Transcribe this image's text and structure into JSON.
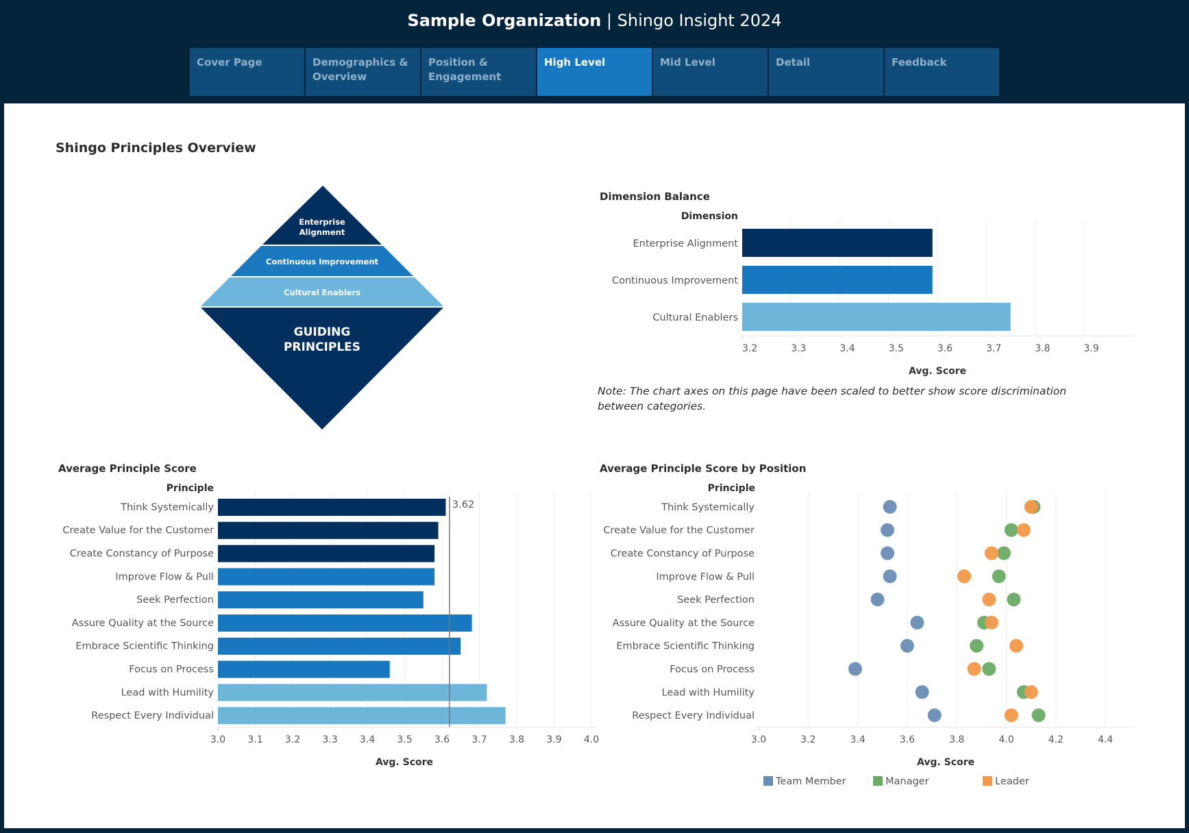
{
  "header": {
    "org_name": "Sample Organization",
    "separator": " | ",
    "report_name": "Shingo Insight 2024"
  },
  "tabs": [
    {
      "label": "Cover Page",
      "active": false
    },
    {
      "label": "Demographics & Overview",
      "active": false
    },
    {
      "label": "Position & Engagement",
      "active": false
    },
    {
      "label": "High Level",
      "active": true
    },
    {
      "label": "Mid Level",
      "active": false
    },
    {
      "label": "Detail",
      "active": false
    },
    {
      "label": "Feedback",
      "active": false
    }
  ],
  "page_title": "Shingo Principles Overview",
  "pyramid": {
    "top": [
      "Enterprise",
      "Alignment"
    ],
    "middle": "Continuous Improvement",
    "lower": "Cultural Enablers",
    "base": [
      "GUIDING",
      "PRINCIPLES"
    ]
  },
  "colors": {
    "enterprise_alignment": "#022f5e",
    "continuous_improvement": "#1777bf",
    "cultural_enablers": "#6eb5da",
    "team_member": "#6a8db5",
    "manager": "#6aaa64",
    "leader": "#f2984a",
    "reference_line": "#888888"
  },
  "note": "Note: The  chart axes on this page have been scaled to better show score discrimination between categories.",
  "chart_data": [
    {
      "id": "dimension_balance",
      "type": "bar",
      "orientation": "horizontal",
      "title": "Dimension Balance",
      "category_header": "Dimension",
      "categories": [
        "Enterprise Alignment",
        "Continuous Improvement",
        "Cultural Enablers"
      ],
      "values": [
        3.59,
        3.59,
        3.75
      ],
      "bar_colors": [
        "#022f5e",
        "#1777bf",
        "#6eb5da"
      ],
      "xlabel": "Avg. Score",
      "xlim": [
        3.2,
        4.0
      ],
      "xticks": [
        "3.2",
        "3.3",
        "3.4",
        "3.5",
        "3.6",
        "3.7",
        "3.8",
        "3.9"
      ],
      "grid": true
    },
    {
      "id": "average_principle_score",
      "type": "bar",
      "orientation": "horizontal",
      "title": "Average Principle Score",
      "category_header": "Principle",
      "categories": [
        "Think Systemically",
        "Create Value for the Customer",
        "Create Constancy of Purpose",
        "Improve Flow & Pull",
        "Seek Perfection",
        "Assure Quality at the Source",
        "Embrace Scientific Thinking",
        "Focus on Process",
        "Lead with Humility",
        "Respect Every Individual"
      ],
      "values": [
        3.61,
        3.59,
        3.58,
        3.58,
        3.55,
        3.68,
        3.65,
        3.46,
        3.72,
        3.77
      ],
      "dimension": [
        "EA",
        "EA",
        "EA",
        "CI",
        "CI",
        "CI",
        "CI",
        "CI",
        "CE",
        "CE"
      ],
      "reference_line": {
        "value": 3.62,
        "label": "3.62"
      },
      "xlabel": "Avg. Score",
      "xlim": [
        3.0,
        4.0
      ],
      "xticks": [
        "3.0",
        "3.1",
        "3.2",
        "3.3",
        "3.4",
        "3.5",
        "3.6",
        "3.7",
        "3.8",
        "3.9",
        "4.0"
      ],
      "grid": true
    },
    {
      "id": "principle_score_by_position",
      "type": "scatter",
      "title": "Average Principle Score by Position",
      "category_header": "Principle",
      "categories": [
        "Think Systemically",
        "Create Value for the Customer",
        "Create Constancy of Purpose",
        "Improve Flow & Pull",
        "Seek Perfection",
        "Assure Quality at the Source",
        "Embrace Scientific Thinking",
        "Focus on Process",
        "Lead with Humility",
        "Respect Every Individual"
      ],
      "series": [
        {
          "name": "Team Member",
          "color": "#6a8db5",
          "values": [
            3.53,
            3.52,
            3.52,
            3.53,
            3.48,
            3.64,
            3.6,
            3.39,
            3.66,
            3.71
          ]
        },
        {
          "name": "Manager",
          "color": "#6aaa64",
          "values": [
            4.11,
            4.02,
            3.99,
            3.97,
            4.03,
            3.91,
            3.88,
            3.93,
            4.07,
            4.13
          ]
        },
        {
          "name": "Leader",
          "color": "#f2984a",
          "values": [
            4.1,
            4.07,
            3.94,
            3.83,
            3.93,
            3.94,
            4.04,
            3.87,
            4.1,
            4.02
          ]
        }
      ],
      "xlabel": "Avg. Score",
      "xlim": [
        3.0,
        4.5
      ],
      "xticks": [
        "3.0",
        "3.2",
        "3.4",
        "3.6",
        "3.8",
        "4.0",
        "4.2",
        "4.4"
      ],
      "legend_position": "bottom",
      "grid": true
    }
  ]
}
